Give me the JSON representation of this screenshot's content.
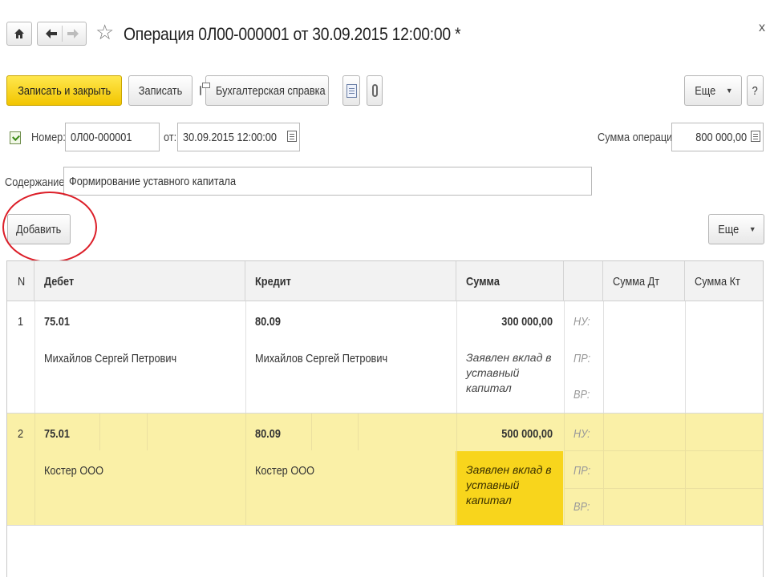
{
  "window": {
    "title": "Операция 0Л00-000001 от 30.09.2015 12:00:00 *",
    "close_label": "x"
  },
  "nav": {
    "home_icon": "home-icon",
    "back_icon": "arrow-left-icon",
    "forward_icon": "arrow-right-icon",
    "favorite_icon": "star-icon"
  },
  "toolbar": {
    "save_close_label": "Записать и закрыть",
    "save_label": "Записать",
    "report_label": "Бухгалтерская справка",
    "more_label": "Еще",
    "help_label": "?"
  },
  "form": {
    "number_label": "Номер:",
    "number_value": "0Л00-000001",
    "date_label": "от:",
    "date_value": "30.09.2015 12:00:00",
    "sum_label": "Сумма операции:",
    "sum_value": "800 000,00",
    "content_label": "Содержание:",
    "content_value": "Формирование уставного капитала"
  },
  "table_toolbar": {
    "add_label": "Добавить",
    "more_label": "Еще"
  },
  "table": {
    "columns": [
      "N",
      "Дебет",
      "Кредит",
      "Сумма",
      "",
      "Сумма Дт",
      "Сумма Кт"
    ],
    "rows": [
      {
        "n": "1",
        "debit_account": "75.01",
        "debit_subconto": "Михайлов Сергей Петрович",
        "credit_account": "80.09",
        "credit_subconto": "Михайлов Сергей Петрович",
        "amount": "300 000,00",
        "comment": "Заявлен вклад в уставный капитал",
        "tags": [
          "НУ:",
          "ПР:",
          "ВР:"
        ]
      },
      {
        "n": "2",
        "debit_account": "75.01",
        "debit_subconto": "Костер ООО",
        "credit_account": "80.09",
        "credit_subconto": "Костер ООО",
        "amount": "500 000,00",
        "comment": "Заявлен вклад в уставный капитал",
        "tags": [
          "НУ:",
          "ПР:",
          "ВР:"
        ]
      }
    ]
  },
  "colors": {
    "primary_button": "#f2c500",
    "selected_row": "#faf0a7",
    "highlight_cell": "#f8d51c",
    "annotation": "#dc1e28"
  }
}
